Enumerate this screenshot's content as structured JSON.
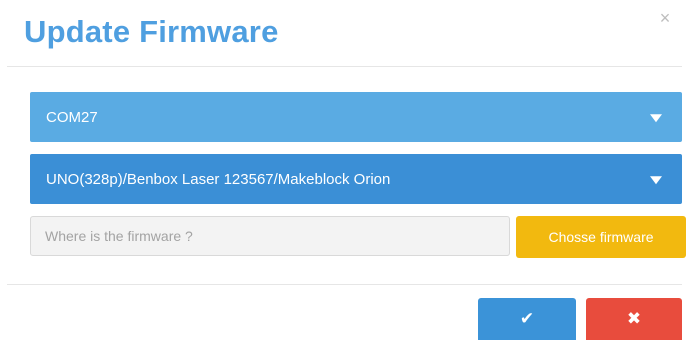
{
  "dialog": {
    "title": "Update Firmware",
    "close_glyph": "×"
  },
  "port_select": {
    "value": "COM27"
  },
  "board_select": {
    "value": "UNO(328p)/Benbox Laser 123567/Makeblock Orion"
  },
  "firmware": {
    "placeholder": "Where is the firmware ?",
    "choose_label": "Chosse firmware"
  },
  "actions": {
    "ok_glyph": "✔",
    "cancel_glyph": "✖"
  },
  "colors": {
    "title": "#4f9fe0",
    "port_select": "#5aabe3",
    "board_select": "#3b8fd6",
    "choose_button": "#f2b90f",
    "ok_button": "#3b93d8",
    "cancel_button": "#e84c3d"
  },
  "icons": {
    "close": "close-icon",
    "caret": "caret-down-icon",
    "ok": "check-icon",
    "cancel": "cross-icon"
  }
}
